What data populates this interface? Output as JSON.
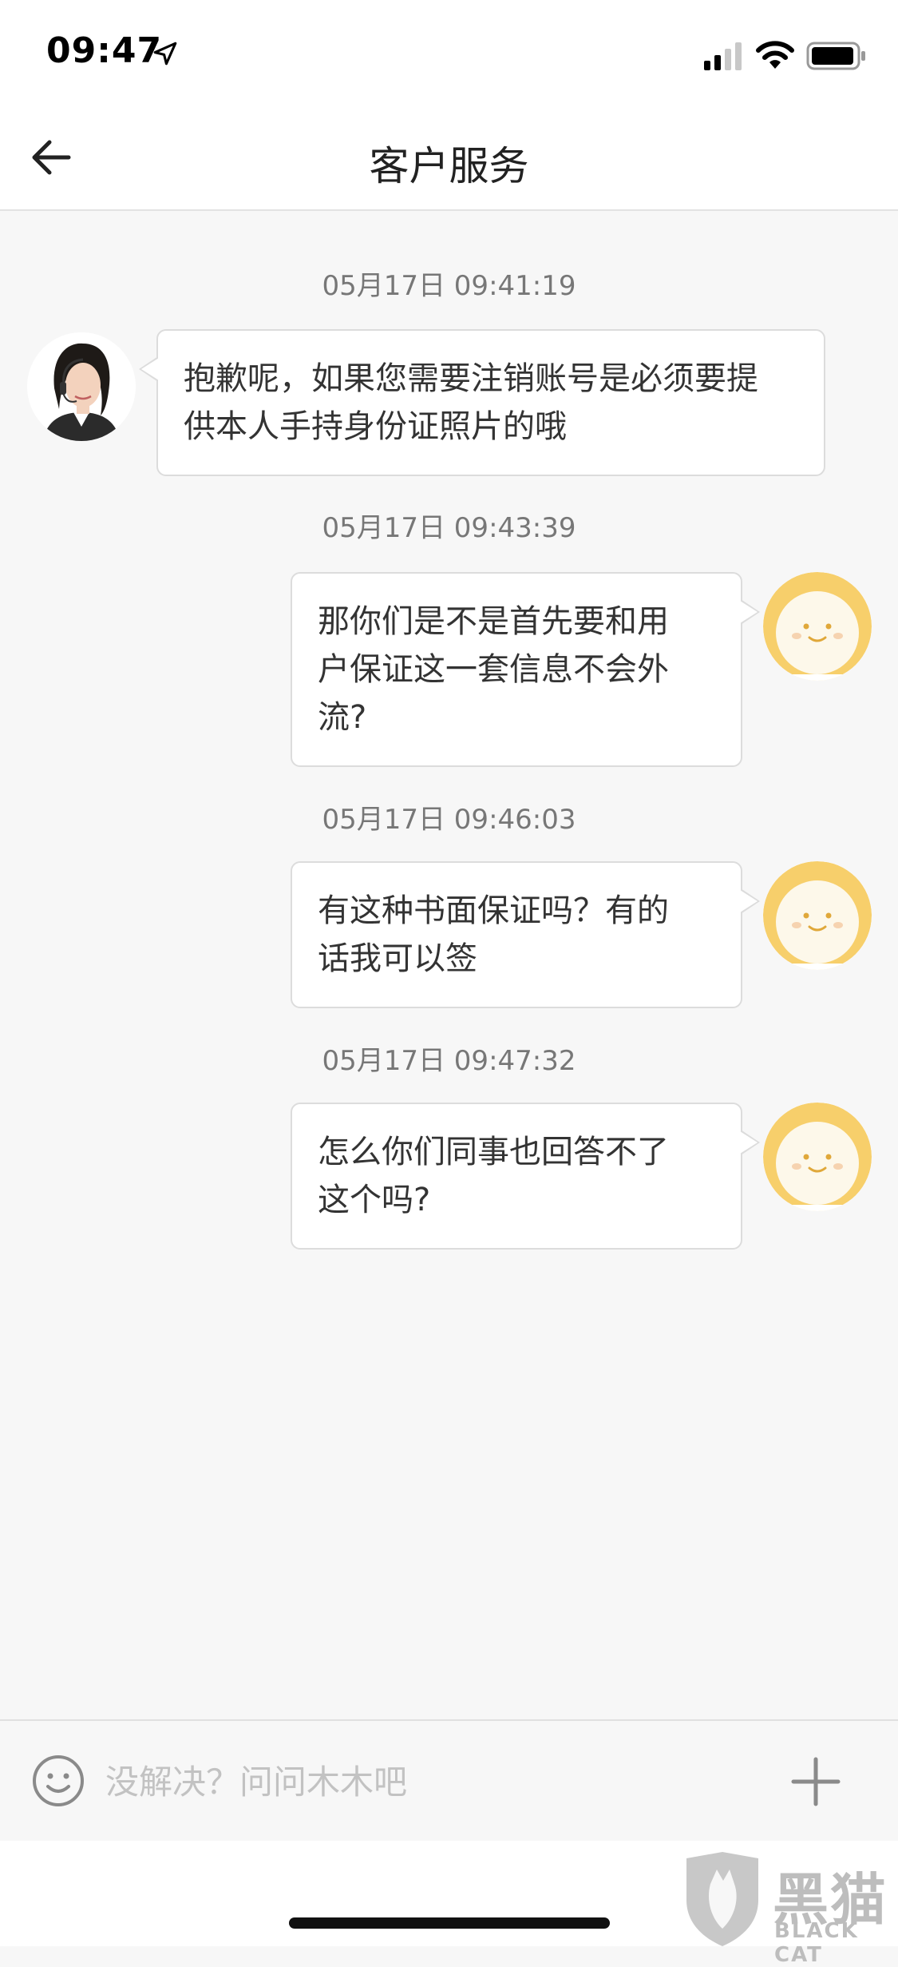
{
  "status_bar": {
    "time": "09:47"
  },
  "nav": {
    "title": "客户服务"
  },
  "messages": [
    {
      "timestamp": "05月17日 09:41:19",
      "sender": "agent",
      "lines": [
        "抱歉呢，如果您需要注销账号是必须要提",
        "供本人手持身份证照片的哦"
      ]
    },
    {
      "timestamp": "05月17日 09:43:39",
      "sender": "user",
      "lines": [
        "那你们是不是首先要和用",
        "户保证这一套信息不会外",
        "流?"
      ]
    },
    {
      "timestamp": "05月17日 09:46:03",
      "sender": "user",
      "lines": [
        "有这种书面保证吗？有的",
        "话我可以签"
      ]
    },
    {
      "timestamp": "05月17日 09:47:32",
      "sender": "user",
      "lines": [
        "怎么你们同事也回答不了",
        "这个吗?"
      ]
    }
  ],
  "input": {
    "placeholder": "没解决？问问木木吧"
  },
  "watermark": {
    "main": "黑猫",
    "sub": "BLACK CAT"
  },
  "colors": {
    "user_avatar": "#f7cf6b",
    "background": "#f7f7f7"
  }
}
